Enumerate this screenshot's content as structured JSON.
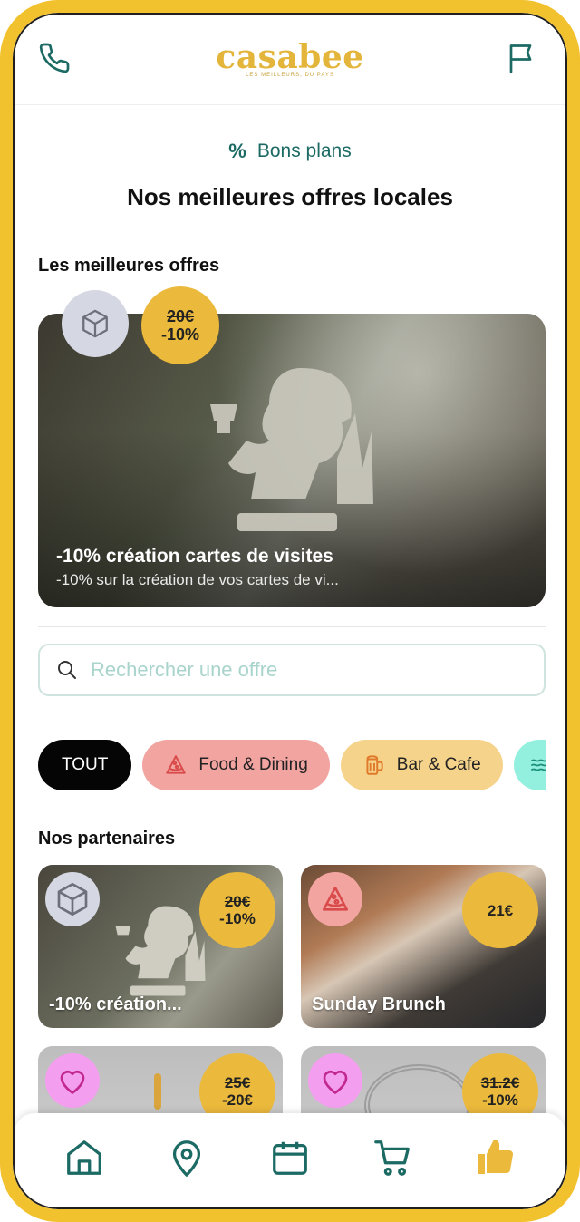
{
  "header": {
    "logo_text": "casabee",
    "logo_tagline": "LES MEILLEURS, DU PAYS",
    "icons": [
      "phone-icon",
      "flag-icon"
    ]
  },
  "eyebrow": {
    "icon": "%",
    "label": "Bons plans"
  },
  "page_title": "Nos meilleures offres locales",
  "best_offers": {
    "title": "Les meilleures offres",
    "hero": {
      "category_icon": "box-icon",
      "old_price": "20€",
      "discount": "-10%",
      "title": "-10% création cartes de visites",
      "subtitle": "-10% sur la création de vos cartes de vi..."
    }
  },
  "search": {
    "placeholder": "Rechercher une offre"
  },
  "chips": [
    {
      "label": "TOUT",
      "icon": ""
    },
    {
      "label": "Food & Dining",
      "icon": "pizza-icon"
    },
    {
      "label": "Bar & Cafe",
      "icon": "beer-icon"
    },
    {
      "label": "",
      "icon": "waves-icon"
    }
  ],
  "partners": {
    "title": "Nos partenaires",
    "cards": [
      {
        "label": "-10% création...",
        "category_icon": "box-icon",
        "old_price": "20€",
        "price": "-10%"
      },
      {
        "label": "Sunday Brunch",
        "category_icon": "pizza-icon",
        "old_price": "",
        "price": "21€"
      },
      {
        "label": "",
        "category_icon": "heart-icon",
        "old_price": "25€",
        "price": "-20€"
      },
      {
        "label": "",
        "category_icon": "heart-icon",
        "old_price": "31.2€",
        "price": "-10%"
      }
    ]
  },
  "bottom_nav": [
    "home-icon",
    "location-icon",
    "calendar-icon",
    "cart-icon",
    "thumbs-up-icon"
  ],
  "colors": {
    "frame": "#f2c12e",
    "accent": "#1c6a64",
    "price_badge": "#ebb93c",
    "food_chip": "#f2a4a1",
    "bar_chip": "#f5d38b",
    "other_chip": "#93f0de",
    "heart_badge": "#f49ef0"
  }
}
